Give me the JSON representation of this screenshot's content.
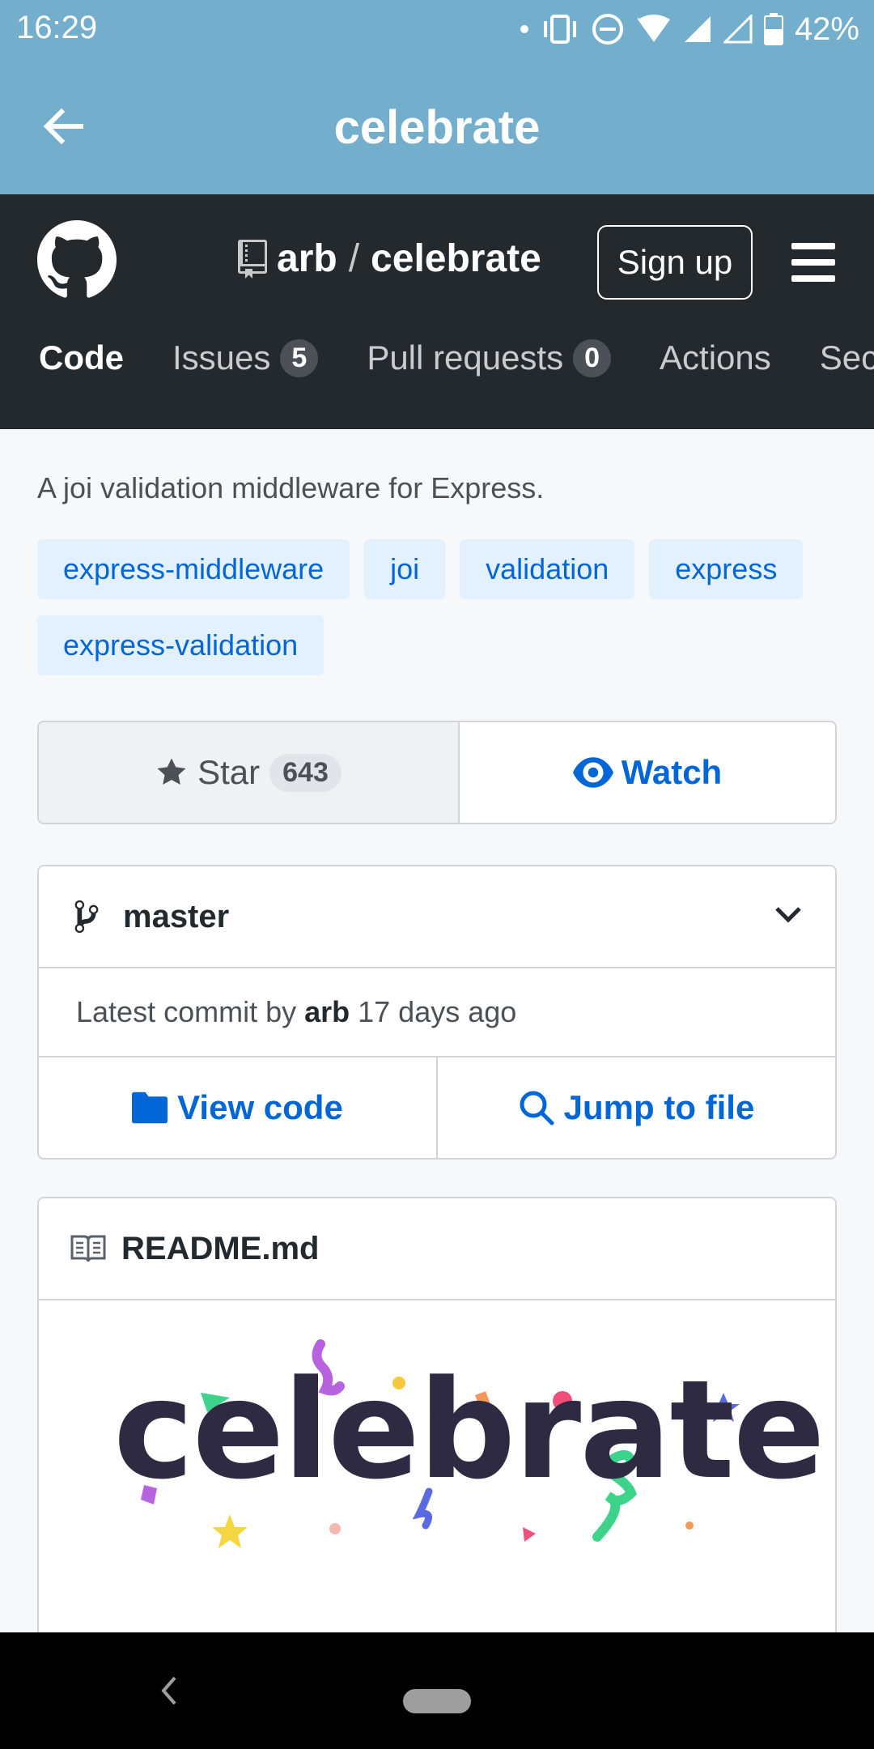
{
  "status_bar": {
    "time": "16:29",
    "battery": "42%"
  },
  "app_bar": {
    "title": "celebrate"
  },
  "header": {
    "owner": "arb",
    "separator": "/",
    "repo": "celebrate",
    "signup_label": "Sign up",
    "tabs": [
      {
        "label": "Code",
        "active": true
      },
      {
        "label": "Issues",
        "count": "5"
      },
      {
        "label": "Pull requests",
        "count": "0"
      },
      {
        "label": "Actions"
      },
      {
        "label": "Sec"
      }
    ]
  },
  "repo": {
    "description": "A joi validation middleware for Express.",
    "topics": [
      "express-middleware",
      "joi",
      "validation",
      "express",
      "express-validation"
    ],
    "star_label": "Star",
    "star_count": "643",
    "watch_label": "Watch"
  },
  "branch": {
    "name": "master",
    "commit_prefix": "Latest commit by ",
    "commit_author": "arb",
    "commit_time": " 17 days ago",
    "view_code_label": "View code",
    "jump_label": "Jump to file"
  },
  "readme": {
    "filename": "README.md",
    "logo_text": "celebrate"
  },
  "colors": {
    "accent": "#0366d6",
    "header_bg": "#24292e",
    "app_bar_bg": "#73afcc"
  }
}
